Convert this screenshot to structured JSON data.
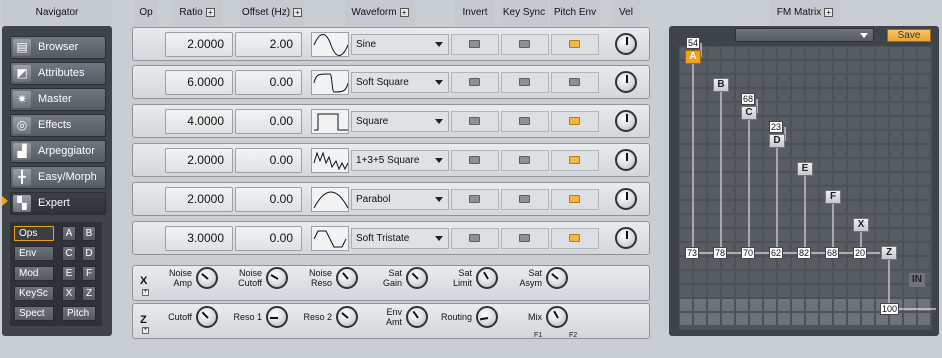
{
  "headers": {
    "navigator": "Navigator",
    "op": "Op",
    "ratio": "Ratio",
    "offset": "Offset (Hz)",
    "waveform": "Waveform",
    "invert": "Invert",
    "key_sync": "Key Sync",
    "pitch_env": "Pitch Env",
    "vel": "Vel",
    "fm_matrix": "FM Matrix",
    "plus": "+"
  },
  "navigator": {
    "items": [
      {
        "label": "Browser",
        "icon": "browser-icon"
      },
      {
        "label": "Attributes",
        "icon": "attributes-icon"
      },
      {
        "label": "Master",
        "icon": "master-icon"
      },
      {
        "label": "Effects",
        "icon": "effects-icon"
      },
      {
        "label": "Arpeggiator",
        "icon": "arpeggiator-icon"
      },
      {
        "label": "Easy/Morph",
        "icon": "easy-morph-icon"
      },
      {
        "label": "Expert",
        "icon": "expert-icon",
        "selected": true
      }
    ],
    "sub": {
      "ops": "Ops",
      "env": "Env",
      "mod": "Mod",
      "keysc": "KeySc",
      "spect": "Spect",
      "pitch": "Pitch",
      "a": "A",
      "b": "B",
      "c": "C",
      "d": "D",
      "e": "E",
      "f": "F",
      "x": "X",
      "z": "Z"
    }
  },
  "operators": [
    {
      "op": "A",
      "ratio": "2.0000",
      "offset": "2.00",
      "waveform": "Sine",
      "invert": false,
      "key_sync": false,
      "pitch_env": true
    },
    {
      "op": "B",
      "ratio": "6.0000",
      "offset": "0.00",
      "waveform": "Soft Square",
      "invert": false,
      "key_sync": false,
      "pitch_env": false
    },
    {
      "op": "C",
      "ratio": "4.0000",
      "offset": "0.00",
      "waveform": "Square",
      "invert": false,
      "key_sync": false,
      "pitch_env": true
    },
    {
      "op": "D",
      "ratio": "2.0000",
      "offset": "0.00",
      "waveform": "1+3+5 Square",
      "invert": false,
      "key_sync": false,
      "pitch_env": true
    },
    {
      "op": "E",
      "ratio": "2.0000",
      "offset": "0.00",
      "waveform": "Parabol",
      "invert": false,
      "key_sync": false,
      "pitch_env": true
    },
    {
      "op": "F",
      "ratio": "3.0000",
      "offset": "0.00",
      "waveform": "Soft Tristate",
      "invert": false,
      "key_sync": false,
      "pitch_env": true
    }
  ],
  "x_row": {
    "label": "X",
    "knobs": [
      {
        "l1": "Noise",
        "l2": "Amp"
      },
      {
        "l1": "Noise",
        "l2": "Cutoff"
      },
      {
        "l1": "Noise",
        "l2": "Reso"
      },
      {
        "l1": "Sat",
        "l2": "Gain"
      },
      {
        "l1": "Sat",
        "l2": "Limit"
      },
      {
        "l1": "Sat",
        "l2": "Asym"
      }
    ]
  },
  "z_row": {
    "label": "Z",
    "knobs": [
      {
        "l1": "Cutoff",
        "l2": ""
      },
      {
        "l1": "Reso 1",
        "l2": ""
      },
      {
        "l1": "Reso 2",
        "l2": ""
      },
      {
        "l1": "Env",
        "l2": "Amt"
      },
      {
        "l1": "Routing",
        "l2": ""
      },
      {
        "l1": "Mix",
        "l2": ""
      }
    ],
    "mix_f1": "F1",
    "mix_f2": "F2"
  },
  "fm_matrix": {
    "save": "Save",
    "ops": [
      "A",
      "B",
      "C",
      "D",
      "E",
      "F",
      "X",
      "Z"
    ],
    "feedback": {
      "A": "54",
      "C": "68",
      "D": "23"
    },
    "outputs": [
      "73",
      "78",
      "70",
      "62",
      "82",
      "68",
      "20"
    ],
    "in_label": "IN",
    "master": "100"
  }
}
